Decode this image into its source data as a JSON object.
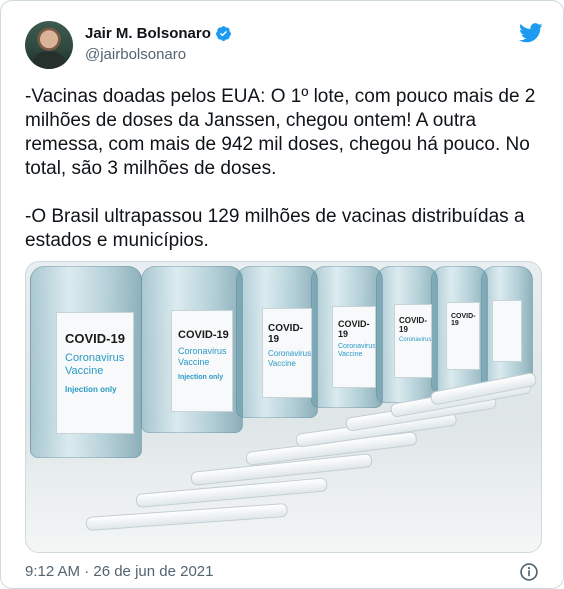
{
  "tweet": {
    "author_name": "Jair M. Bolsonaro",
    "handle": "@jairbolsonaro",
    "text": "-Vacinas doadas pelos EUA: O 1º lote, com pouco mais de 2 milhões de doses da Janssen, chegou ontem! A outra remessa, com mais de 942 mil doses, chegou há pouco. No total, são 3 milhões de doses.\n\n-O Brasil ultrapassou 129 milhões de vacinas distribuídas a estados e municípios.",
    "timestamp": "9:12 AM · 26 de jun de 2021"
  },
  "media": {
    "label_title": "COVID-19",
    "label_line1": "Coronavirus",
    "label_line2": "Vaccine",
    "label_line3": "Injection only"
  },
  "colors": {
    "brand_blue": "#1d9bf0",
    "text": "#0f1419",
    "muted": "#536471"
  },
  "icons": [
    "verified-badge-icon",
    "twitter-bird-icon",
    "info-icon"
  ]
}
